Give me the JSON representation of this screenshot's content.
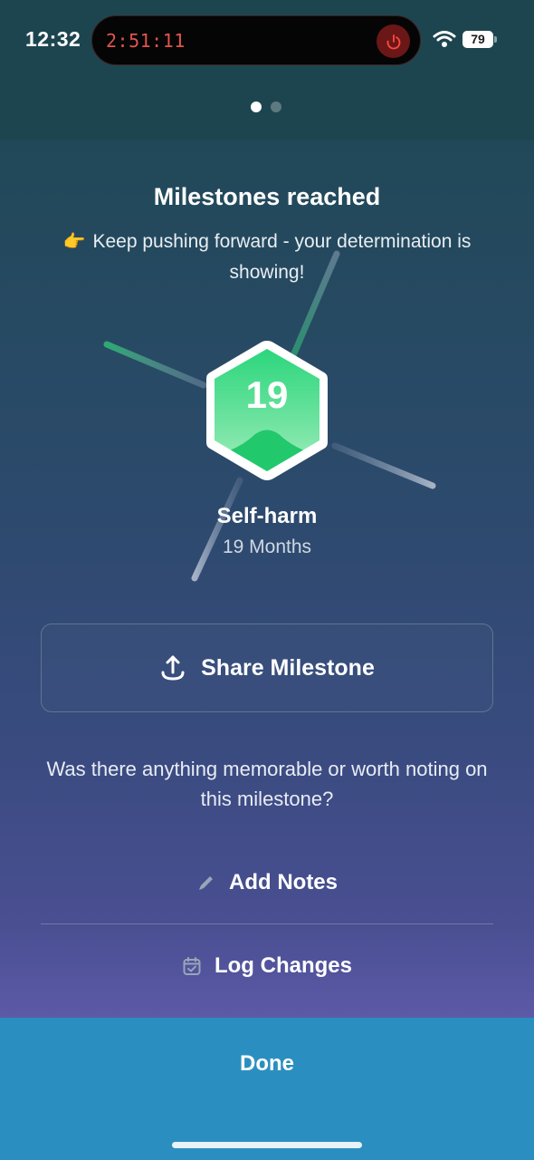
{
  "status_bar": {
    "time": "12:32",
    "timer": "2:51:11",
    "battery_level": "79"
  },
  "pager": {
    "page_count": 2,
    "active_index": 0
  },
  "header": {
    "title": "Milestones reached",
    "emoji": "👉",
    "subtitle": "Keep pushing forward - your determination is showing!"
  },
  "milestone": {
    "badge_number": "19",
    "category": "Self-harm",
    "duration": "19 Months",
    "badge_color": "#2fd47a"
  },
  "actions": {
    "share_label": "Share Milestone",
    "prompt": "Was there anything memorable or worth noting on this milestone?",
    "notes_label": "Add Notes",
    "log_label": "Log Changes",
    "done_label": "Done"
  },
  "icons": {
    "share": "share-upload-icon",
    "notes": "pencil-icon",
    "log": "calendar-check-icon",
    "power": "power-icon",
    "wifi": "wifi-icon"
  },
  "colors": {
    "accent": "#2a8fc0",
    "timer_red": "#e0554d"
  }
}
